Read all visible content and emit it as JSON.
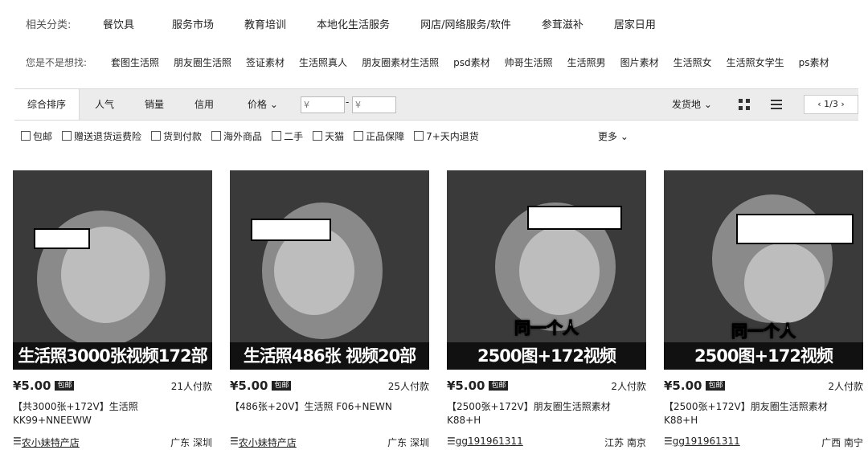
{
  "categories": {
    "label": "相关分类:",
    "items": [
      "餐饮具",
      "服务市场",
      "教育培训",
      "本地化生活服务",
      "网店/网络服务/软件",
      "参茸滋补",
      "居家日用"
    ]
  },
  "suggestions": {
    "label": "您是不是想找:",
    "items": [
      "套图生活照",
      "朋友圈生活照",
      "签证素材",
      "生活照真人",
      "朋友圈素材生活照",
      "psd素材",
      "帅哥生活照",
      "生活照男",
      "图片素材",
      "生活照女",
      "生活照女学生",
      "ps素材"
    ]
  },
  "sort": {
    "default": "综合排序",
    "options": [
      "人气",
      "销量",
      "信用",
      "价格"
    ],
    "price_min_placeholder": "¥",
    "price_max_placeholder": "¥",
    "ship_from": "发货地",
    "page": "1/3"
  },
  "filters": {
    "items": [
      "包邮",
      "赠送退货运费险",
      "货到付款",
      "海外商品",
      "二手",
      "天猫",
      "正品保障",
      "7+天内退货"
    ],
    "more": "更多"
  },
  "products": [
    {
      "caption": "生活照3000张视频172部",
      "overlay": "",
      "price": "¥5.00",
      "badge": "包邮",
      "paid": "21人付款",
      "title": "【共3000张+172V】生活照KK99+NNEEWW",
      "shop": "农小妹特产店",
      "location": "广东 深圳"
    },
    {
      "caption": "生活照486张 视频20部",
      "overlay": "",
      "price": "¥5.00",
      "badge": "包邮",
      "paid": "25人付款",
      "title": "【486张+20V】生活照 F06+NEWN",
      "shop": "农小妹特产店",
      "location": "广东 深圳"
    },
    {
      "caption": "2500图+172视频",
      "overlay": "同一个人",
      "price": "¥5.00",
      "badge": "包邮",
      "paid": "2人付款",
      "title": "【2500张+172V】朋友圈生活照素材K88+H",
      "shop": "gg191961311",
      "location": "江苏 南京"
    },
    {
      "caption": "2500图+172视频",
      "overlay": "同一个人",
      "price": "¥5.00",
      "badge": "包邮",
      "paid": "2人付款",
      "title": "【2500张+172V】朋友圈生活照素材K88+H",
      "shop": "gg191961311",
      "location": "广西 南宁"
    }
  ]
}
